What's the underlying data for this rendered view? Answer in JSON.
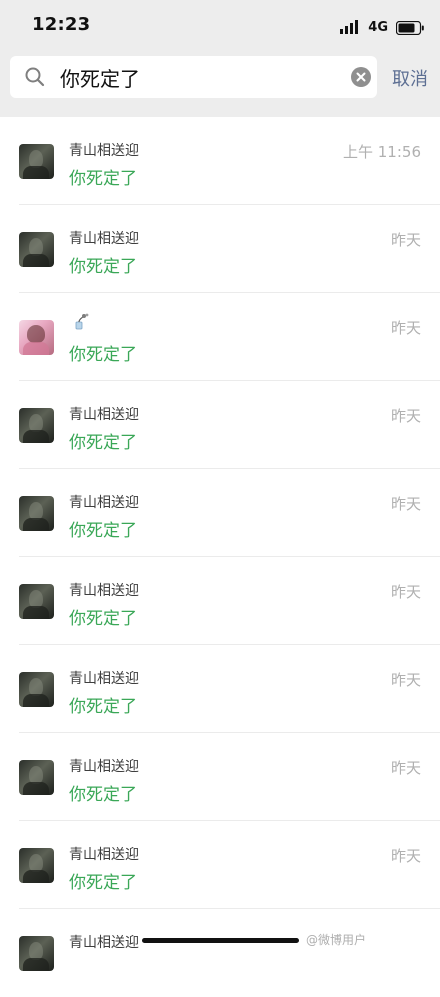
{
  "status_bar": {
    "time": "12:23",
    "network": "4G",
    "icons": [
      "signal-icon",
      "battery-icon"
    ]
  },
  "search": {
    "query": "你死定了",
    "cancel_label": "取消",
    "icons": [
      "search-icon",
      "clear-icon"
    ]
  },
  "results": [
    {
      "name": "青山相送迎",
      "message": "你死定了",
      "time": "上午 11:56",
      "avatar": "dark"
    },
    {
      "name": "青山相送迎",
      "message": "你死定了",
      "time": "昨天",
      "avatar": "dark"
    },
    {
      "name": "",
      "message": "你死定了",
      "time": "昨天",
      "avatar": "girl",
      "name_icon": "flower-icon"
    },
    {
      "name": "青山相送迎",
      "message": "你死定了",
      "time": "昨天",
      "avatar": "dark"
    },
    {
      "name": "青山相送迎",
      "message": "你死定了",
      "time": "昨天",
      "avatar": "dark"
    },
    {
      "name": "青山相送迎",
      "message": "你死定了",
      "time": "昨天",
      "avatar": "dark"
    },
    {
      "name": "青山相送迎",
      "message": "你死定了",
      "time": "昨天",
      "avatar": "dark"
    },
    {
      "name": "青山相送迎",
      "message": "你死定了",
      "time": "昨天",
      "avatar": "dark"
    },
    {
      "name": "青山相送迎",
      "message": "你死定了",
      "time": "昨天",
      "avatar": "dark"
    },
    {
      "name": "青山相送迎",
      "message": "",
      "time": "",
      "avatar": "dark"
    }
  ],
  "watermark": "@微博用户",
  "colors": {
    "header_bg": "#ededed",
    "highlight": "#3aa757",
    "cancel": "#5d6f93",
    "time": "#b0b0b0"
  }
}
